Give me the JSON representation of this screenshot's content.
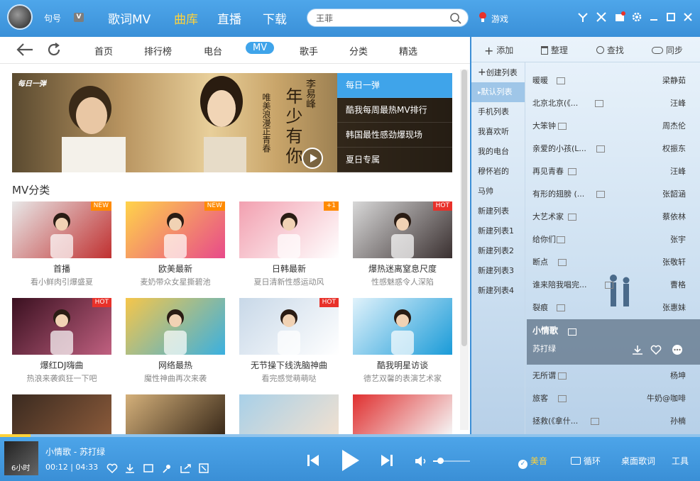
{
  "topbar": {
    "username": "句号",
    "vip_badge": "V",
    "nav": [
      "歌词MV",
      "曲库",
      "直播",
      "下载"
    ],
    "active_nav": "曲库",
    "search_value": "王菲",
    "game_label": "游戏"
  },
  "subnav": [
    "首页",
    "排行榜",
    "电台",
    "MV",
    "歌手",
    "分类",
    "精选"
  ],
  "banner": {
    "logo": "每日一弹",
    "title": "年少有你",
    "artist": "李易峰",
    "subtitle": "唯美浪漫正青春",
    "items": [
      "每日一弹",
      "酷我每周最热MV排行",
      "韩国最性感劲爆现场",
      "夏日专属"
    ]
  },
  "mv_section_title": "MV分类",
  "mv_cards": [
    {
      "title": "首播",
      "sub": "看小鲜肉引爆盛夏",
      "badge": "NEW",
      "badge_color": "#ff8a00"
    },
    {
      "title": "欧美最新",
      "sub": "麦奶带众女星撕碧池",
      "badge": "NEW",
      "badge_color": "#ff8a00"
    },
    {
      "title": "日韩最新",
      "sub": "夏日清新性感运动风",
      "badge": "+1",
      "badge_color": "#ff8a00"
    },
    {
      "title": "爆热迷离窒息尺度",
      "sub": "性感魅惑令人深陷",
      "badge": "HOT",
      "badge_color": "#e8312a"
    },
    {
      "title": "爆红DJ嗨曲",
      "sub": "热浪来袭疯狂一下吧",
      "badge": "HOT",
      "badge_color": "#e8312a"
    },
    {
      "title": "网络最热",
      "sub": "魔性神曲再次来袭",
      "badge": "",
      "badge_color": ""
    },
    {
      "title": "无节操下线洗脑神曲",
      "sub": "看完感觉萌萌哒",
      "badge": "HOT",
      "badge_color": "#e8312a"
    },
    {
      "title": "酷我明星访谈",
      "sub": "德艺双馨的表演艺术家",
      "badge": "",
      "badge_color": ""
    }
  ],
  "right_tools": [
    "添加",
    "整理",
    "查找",
    "同步"
  ],
  "playlists": [
    "创建列表",
    "默认列表",
    "手机列表",
    "我喜欢听",
    "我的电台",
    "穆怀岩的",
    "马帅",
    "新建列表",
    "新建列表1",
    "新建列表2",
    "新建列表3",
    "新建列表4"
  ],
  "songs": [
    {
      "name": "暖暖",
      "artist": "梁静茹"
    },
    {
      "name": "北京北京(《...",
      "artist": "汪峰"
    },
    {
      "name": "大笨钟",
      "artist": "周杰伦"
    },
    {
      "name": "亲爱的小孩(L...",
      "artist": "权振东"
    },
    {
      "name": "再见青春",
      "artist": "汪峰"
    },
    {
      "name": "有形的翅膀 (...",
      "artist": "张韶涵"
    },
    {
      "name": "大艺术家",
      "artist": "蔡依林"
    },
    {
      "name": "给你们",
      "artist": "张宇"
    },
    {
      "name": "断点",
      "artist": "张敬轩"
    },
    {
      "name": "谁来陪我唱完...",
      "artist": "曹格"
    },
    {
      "name": "裂痕",
      "artist": "张惠妹"
    },
    {
      "name": "小情歌",
      "artist": "苏打绿",
      "current": true
    },
    {
      "name": "无所谓",
      "artist": "杨坤"
    },
    {
      "name": "旅客",
      "artist": "牛奶@咖啡"
    },
    {
      "name": "拯救(《拿什...",
      "artist": "孙楠"
    }
  ],
  "player": {
    "title": "小情歌 - 苏打绿",
    "elapsed": "00:12",
    "duration": "04:33",
    "progress": 0.044,
    "volume": 0.2,
    "sound_effect": "美音",
    "loop_label": "循环",
    "desktop_lyrics": "桌面歌词",
    "tools": "工具",
    "album_label": "6小时"
  },
  "colors": {
    "accent": "#3fa4ea",
    "active_nav": "#ffd23a",
    "topbar": "#3d8fd6"
  }
}
